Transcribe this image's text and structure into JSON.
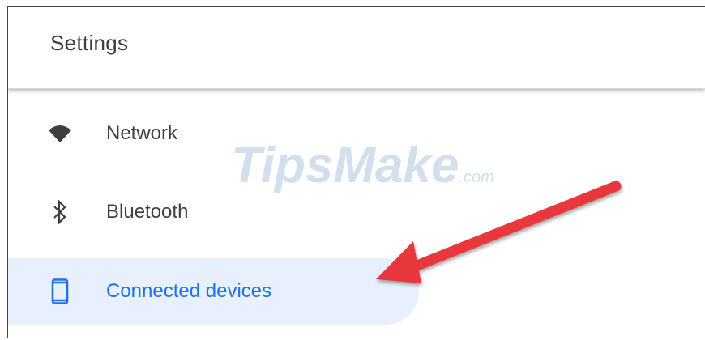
{
  "header": {
    "title": "Settings"
  },
  "menu": {
    "items": [
      {
        "label": "Network",
        "icon": "wifi-icon"
      },
      {
        "label": "Bluetooth",
        "icon": "bluetooth-icon"
      },
      {
        "label": "Connected devices",
        "icon": "phone-icon",
        "selected": true
      }
    ]
  },
  "watermark": {
    "brand": "TipsMake",
    "suffix": ".com"
  },
  "colors": {
    "accent": "#1a73e8",
    "selected_bg": "#e8f0fe",
    "text": "#3c4043",
    "arrow": "#e8383d"
  }
}
